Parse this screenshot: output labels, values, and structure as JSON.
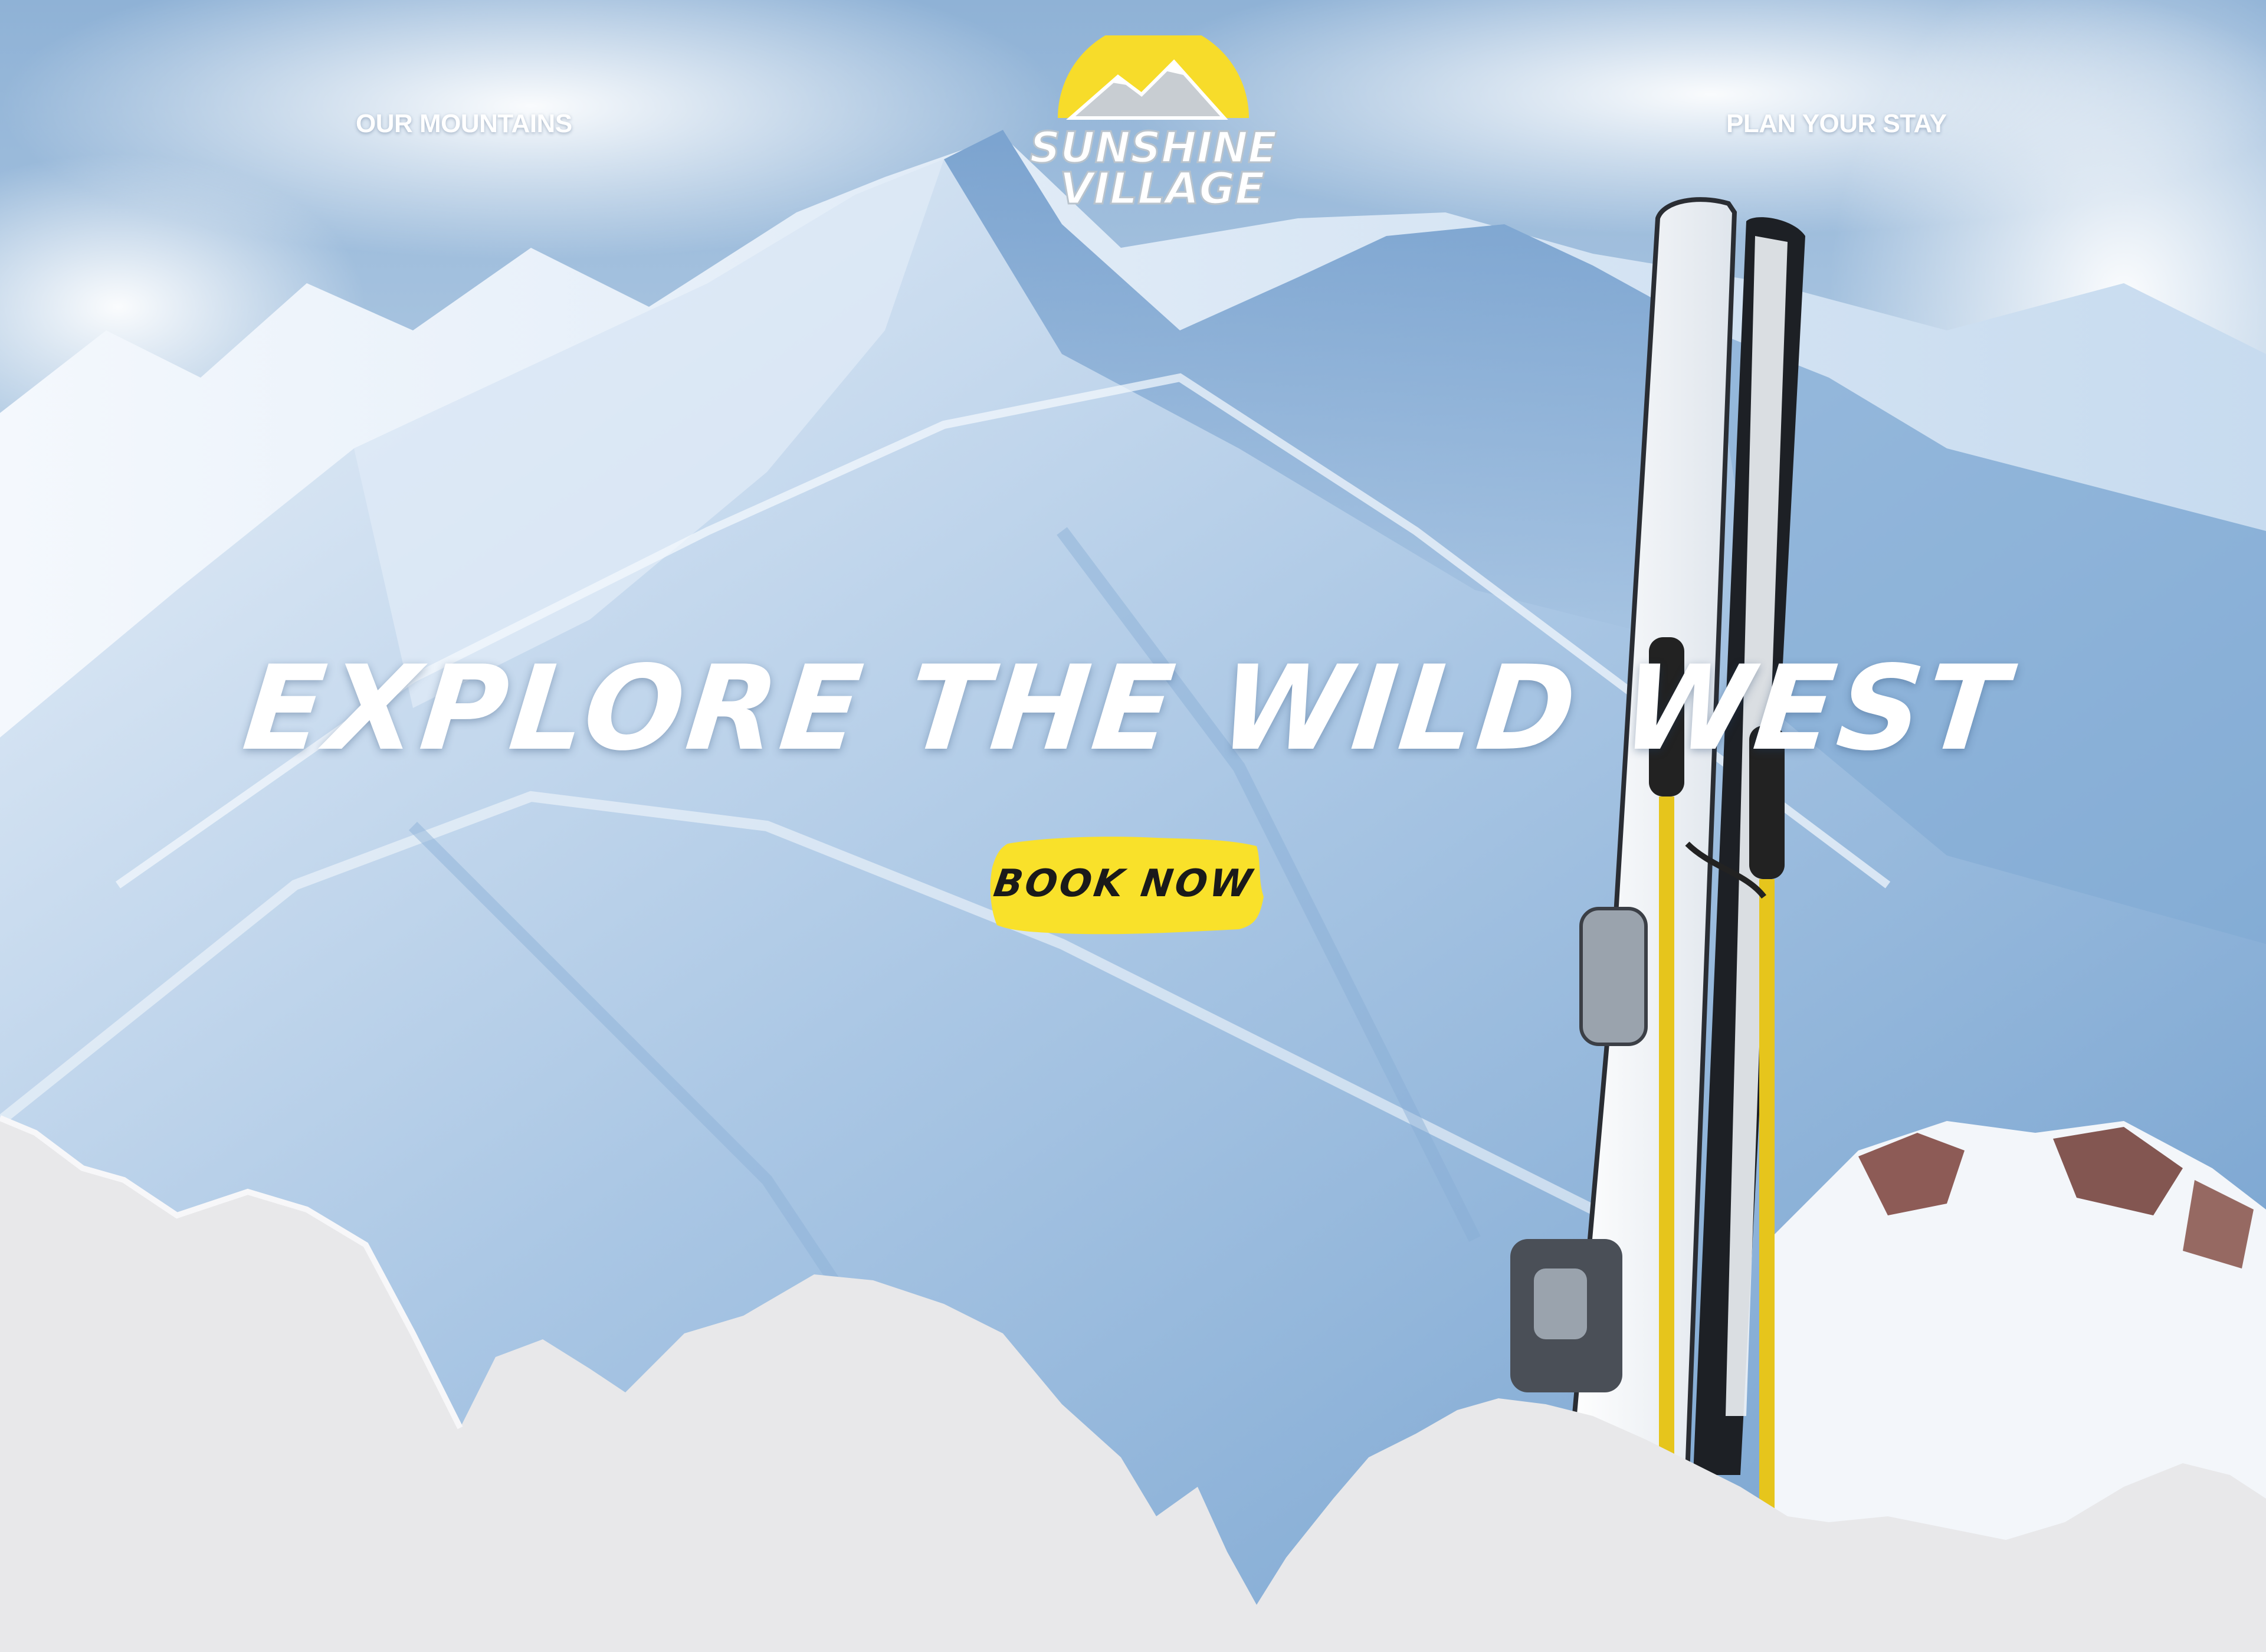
{
  "nav": {
    "left_label": "OUR MOUNTAINS",
    "right_label": "PLAN YOUR STAY"
  },
  "logo": {
    "line1": "SUNSHINE",
    "line2": "VILLAGE",
    "sun_color": "#f7dc2a"
  },
  "hero": {
    "title": "EXPLORE THE WILD WEST",
    "cta_label": "BOOK NOW",
    "cta_color": "#f9e12a"
  },
  "background": {
    "description_icon": "mountain-ski-photo",
    "snow_color": "#e8e8ea",
    "sky_color": "#9dbcdc"
  }
}
